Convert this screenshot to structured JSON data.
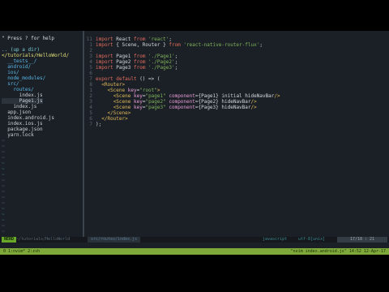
{
  "nerdtree": {
    "help": "\" Press ? for help",
    "updir": ".. (up a dir)",
    "root": "</tutorials/HelloWorld/",
    "entries": [
      {
        "text": "  __tests__/",
        "kind": "dir"
      },
      {
        "text": "  android/",
        "kind": "dir"
      },
      {
        "text": "  ios/",
        "kind": "dir"
      },
      {
        "text": "  node_modules/",
        "kind": "dir"
      },
      {
        "text": "  src/",
        "kind": "dir"
      },
      {
        "text": "    routes/",
        "kind": "dir"
      },
      {
        "text": "      index.js",
        "kind": "file"
      },
      {
        "text": "      Page1.js",
        "kind": "file"
      },
      {
        "text": "    index.js",
        "kind": "file"
      },
      {
        "text": "  app.json",
        "kind": "file"
      },
      {
        "text": "  index.android.js",
        "kind": "file"
      },
      {
        "text": "  index.ios.js",
        "kind": "file"
      },
      {
        "text": "  package.json",
        "kind": "file"
      },
      {
        "text": "  yarn.lock",
        "kind": "file"
      }
    ],
    "tilde": "~"
  },
  "editor": {
    "lines": [
      {
        "num": "11",
        "tokens": [
          [
            "kw",
            "import"
          ],
          [
            "id",
            " React "
          ],
          [
            "kw",
            "from"
          ],
          [
            "str",
            " 'react'"
          ],
          [
            "id",
            ";"
          ]
        ]
      },
      {
        "num": "1",
        "tokens": [
          [
            "kw",
            "import"
          ],
          [
            "id",
            " { Scene, Router } "
          ],
          [
            "kw",
            "from"
          ],
          [
            "str",
            " 'react-native-router-flux'"
          ],
          [
            "id",
            ";"
          ]
        ]
      },
      {
        "num": "2",
        "tokens": []
      },
      {
        "num": "3",
        "tokens": [
          [
            "kw",
            "import"
          ],
          [
            "id",
            " Page1 "
          ],
          [
            "kw",
            "from"
          ],
          [
            "str",
            " './Page1'"
          ],
          [
            "id",
            ";"
          ]
        ]
      },
      {
        "num": "4",
        "tokens": [
          [
            "kw",
            "import"
          ],
          [
            "id",
            " Page2 "
          ],
          [
            "kw",
            "from"
          ],
          [
            "str",
            " './Page2'"
          ],
          [
            "id",
            ";"
          ]
        ]
      },
      {
        "num": "5",
        "tokens": [
          [
            "kw",
            "import"
          ],
          [
            "id",
            " Page3 "
          ],
          [
            "kw",
            "from"
          ],
          [
            "str",
            " './Page3'"
          ],
          [
            "id",
            ";"
          ]
        ]
      },
      {
        "num": "6",
        "tokens": []
      },
      {
        "num": "7",
        "tokens": [
          [
            "kw",
            "export default"
          ],
          [
            "id",
            " () => ("
          ]
        ]
      },
      {
        "num": "8",
        "tokens": [
          [
            "id",
            "  "
          ],
          [
            "tag",
            "<Router>"
          ]
        ]
      },
      {
        "num": "1",
        "tokens": [
          [
            "id",
            "    "
          ],
          [
            "tag",
            "<Scene"
          ],
          [
            "attr",
            " key"
          ],
          [
            "id",
            "="
          ],
          [
            "str",
            "\"root\""
          ],
          [
            "tag",
            ">"
          ]
        ]
      },
      {
        "num": "2",
        "tokens": [
          [
            "id",
            "      "
          ],
          [
            "tag",
            "<Scene"
          ],
          [
            "attr",
            " key"
          ],
          [
            "id",
            "="
          ],
          [
            "str",
            "\"page1\""
          ],
          [
            "attr",
            " component"
          ],
          [
            "id",
            "={Page1} initial hideNavBar"
          ],
          [
            "tag",
            "/>"
          ]
        ]
      },
      {
        "num": "3",
        "tokens": [
          [
            "id",
            "      "
          ],
          [
            "tag",
            "<Scene"
          ],
          [
            "attr",
            " key"
          ],
          [
            "id",
            "="
          ],
          [
            "str",
            "\"page2\""
          ],
          [
            "attr",
            " component"
          ],
          [
            "id",
            "={Page2} hideNavBar"
          ],
          [
            "tag",
            "/>"
          ]
        ]
      },
      {
        "num": "4",
        "tokens": [
          [
            "id",
            "      "
          ],
          [
            "tag",
            "<Scene"
          ],
          [
            "attr",
            " key"
          ],
          [
            "id",
            "="
          ],
          [
            "str",
            "\"page3\""
          ],
          [
            "attr",
            " component"
          ],
          [
            "id",
            "={Page3} hideNavBar"
          ],
          [
            "tag",
            "/>"
          ]
        ]
      },
      {
        "num": "5",
        "tokens": [
          [
            "id",
            "    "
          ],
          [
            "tag",
            "</Scene>"
          ]
        ]
      },
      {
        "num": "6",
        "tokens": [
          [
            "id",
            "  "
          ],
          [
            "tag",
            "</Router>"
          ]
        ]
      },
      {
        "num": "7",
        "tokens": [
          [
            "brace",
            ");"
          ]
        ]
      }
    ]
  },
  "statusline": {
    "mode": "NERD",
    "tree": "~/tutorials/HelloWorld",
    "file": "src/routes/index.js",
    "filetype": "javascript",
    "encoding": "utf-8[unix]",
    "position": "17/18 : 21"
  },
  "cmdline": "",
  "tmux": {
    "left": "0  1:nvim* 2:zsh",
    "right": "\"nvim index.android.js\" 14:52 12-Apr-17"
  },
  "colors": {
    "background": "#1b2026",
    "mode_bg": "#6aa82a",
    "tmux_bg": "#7fa83a",
    "keyword": "#e36b5d",
    "string": "#7fb35a"
  }
}
